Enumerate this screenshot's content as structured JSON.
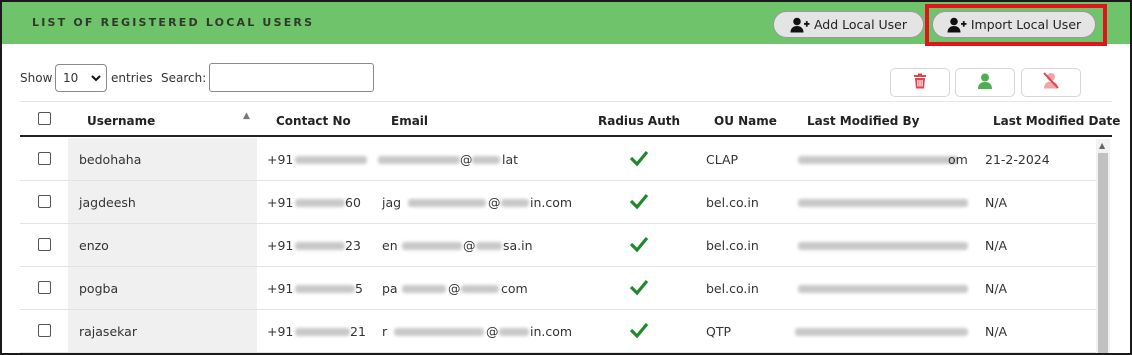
{
  "header": {
    "title": "LIST OF REGISTERED LOCAL USERS",
    "add_label": "Add Local User",
    "import_label": "Import Local User"
  },
  "controls": {
    "show_label": "Show",
    "page_size": "10",
    "entries_label": "entries",
    "search_label": "Search:",
    "search_value": ""
  },
  "columns": [
    "Username",
    "Contact No",
    "Email",
    "Radius Auth",
    "OU Name",
    "Last Modified By",
    "Last Modified Date"
  ],
  "rows": [
    {
      "username": "bedohaha",
      "contact": "+91",
      "email_start": "",
      "email_end": "lat",
      "ou": "CLAP",
      "modified_by_end": "om",
      "date": "21-2-2024"
    },
    {
      "username": "jagdeesh",
      "contact": "+91",
      "contact_end": "60",
      "email_start": "jag",
      "email_end": "in.com",
      "ou": "bel.co.in",
      "modified_by_end": "",
      "date": "N/A"
    },
    {
      "username": "enzo",
      "contact": "+91",
      "contact_end": "23",
      "email_start": "en",
      "email_end": "sa.in",
      "ou": "bel.co.in",
      "modified_by_end": "",
      "date": "N/A"
    },
    {
      "username": "pogba",
      "contact": "+91",
      "contact_end": "5",
      "email_start": "pa",
      "email_end": "com",
      "ou": "bel.co.in",
      "modified_by_end": "",
      "date": "N/A"
    },
    {
      "username": "rajasekar",
      "contact": "+91",
      "contact_end": "21",
      "email_start": "r",
      "email_end": "in.com",
      "ou": "QTP",
      "modified_by_end": "",
      "date": "N/A"
    }
  ],
  "colors": {
    "header_bg": "#6fc36a",
    "highlight": "#e0141b",
    "tick": "#1f8a2b",
    "delete": "#e0434b",
    "enable": "#4caf50"
  }
}
